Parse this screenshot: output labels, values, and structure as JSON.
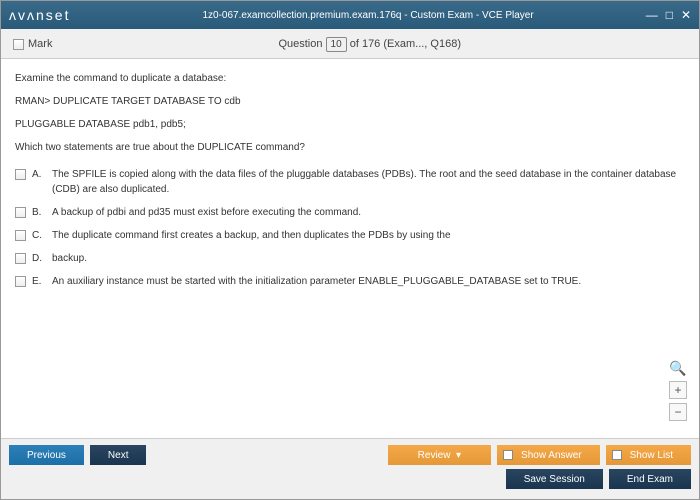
{
  "window": {
    "logo": "ᴧvᴧnset",
    "title": "1z0-067.examcollection.premium.exam.176q - Custom Exam - VCE Player",
    "minimize": "—",
    "maximize": "□",
    "close": "✕"
  },
  "header": {
    "mark_label": "Mark",
    "question_word": "Question",
    "question_num": "10",
    "of_text": " of 176 (Exam..., Q168)"
  },
  "content": {
    "intro": "Examine the command to duplicate a database:",
    "cmd1": "RMAN> DUPLICATE TARGET DATABASE TO cdb",
    "cmd2": "PLUGGABLE DATABASE pdb1, pdb5;",
    "prompt": "Which two statements are true about the DUPLICATE command?"
  },
  "options": [
    {
      "letter": "A.",
      "text": "The SPFILE is copied along with the data files of the pluggable databases (PDBs). The root and the seed database in the container database (CDB) are also duplicated."
    },
    {
      "letter": "B.",
      "text": "A backup of pdbi and pd35 must exist before executing the command."
    },
    {
      "letter": "C.",
      "text": "The duplicate command first creates a backup, and then duplicates the PDBs by using the"
    },
    {
      "letter": "D.",
      "text": "backup."
    },
    {
      "letter": "E.",
      "text": "An auxiliary instance must be started with the initialization parameter ENABLE_PLUGGABLE_DATABASE set to TRUE."
    }
  ],
  "footer": {
    "previous": "Previous",
    "next": "Next",
    "review": "Review",
    "show_answer": "Show Answer",
    "show_list": "Show List",
    "save_session": "Save Session",
    "end_exam": "End Exam"
  },
  "zoom": {
    "plus": "+",
    "minus": "−",
    "mag": "🔍"
  }
}
